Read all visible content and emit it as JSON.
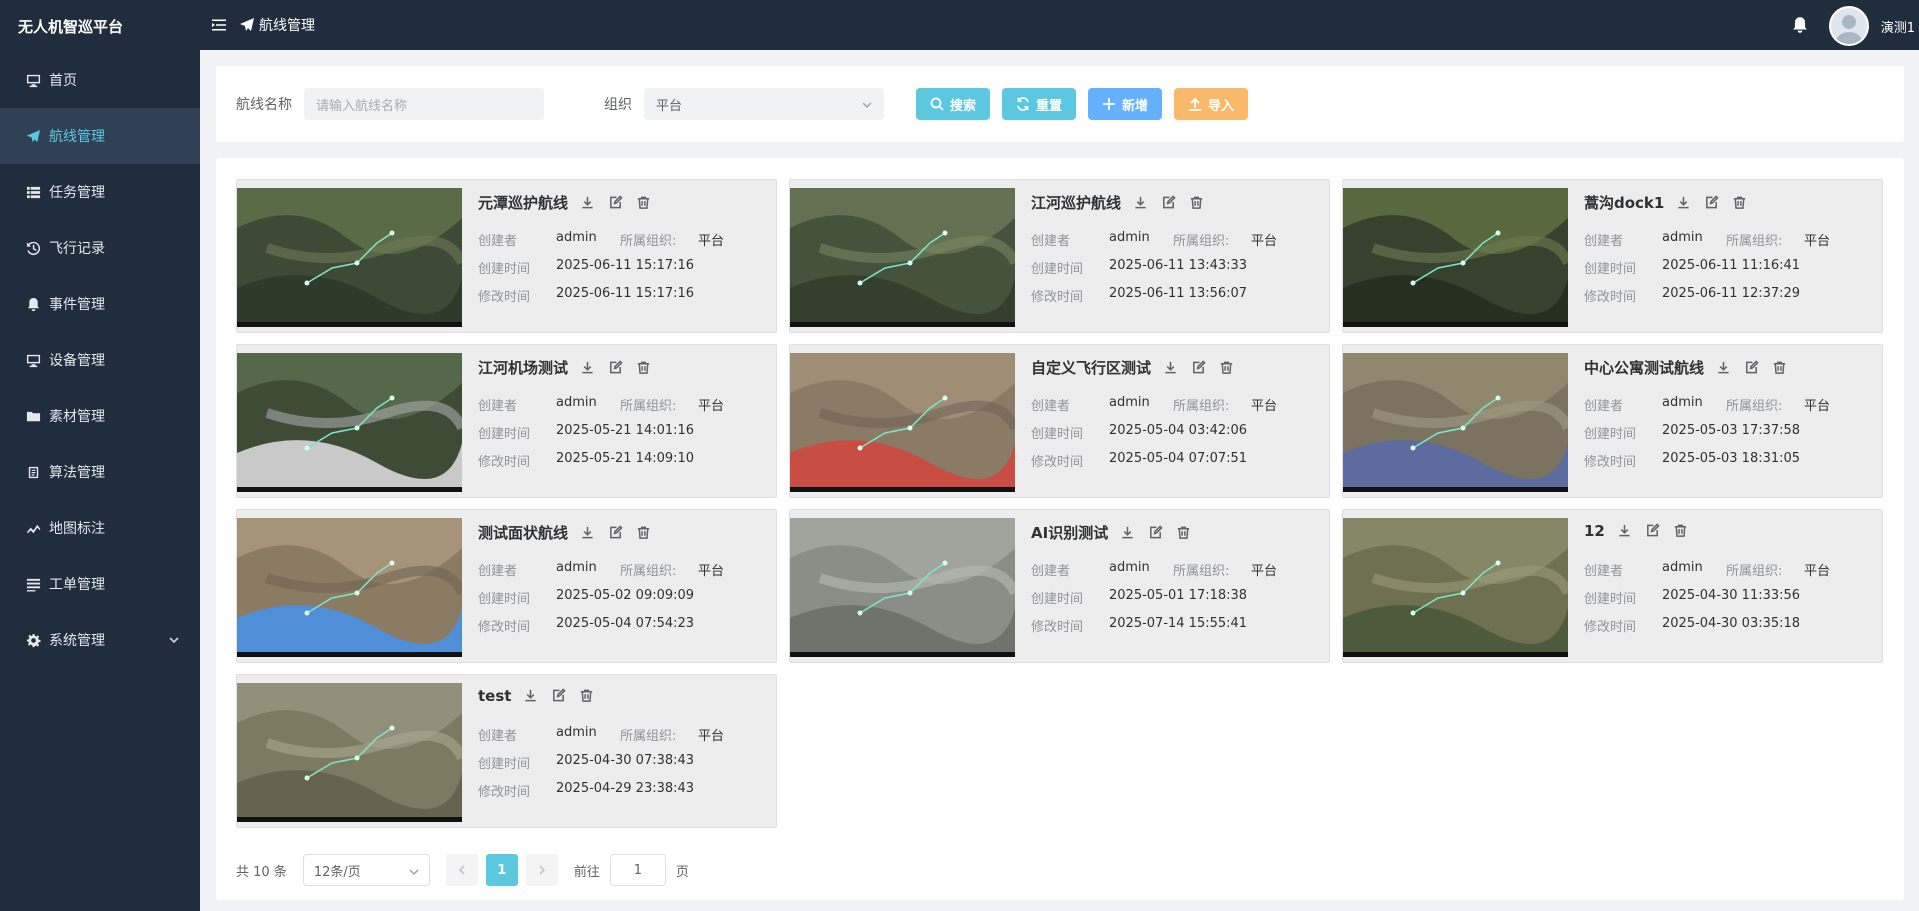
{
  "app": {
    "title": "无人机智巡平台"
  },
  "sidebar": {
    "items": [
      {
        "label": "首页",
        "icon": "monitor-icon"
      },
      {
        "label": "航线管理",
        "icon": "airplane-icon",
        "active": true
      },
      {
        "label": "任务管理",
        "icon": "list-icon"
      },
      {
        "label": "飞行记录",
        "icon": "history-icon"
      },
      {
        "label": "事件管理",
        "icon": "bell-icon"
      },
      {
        "label": "设备管理",
        "icon": "monitor-icon"
      },
      {
        "label": "素材管理",
        "icon": "folder-icon"
      },
      {
        "label": "算法管理",
        "icon": "chip-icon"
      },
      {
        "label": "地图标注",
        "icon": "marker-icon"
      },
      {
        "label": "工单管理",
        "icon": "list-icon"
      },
      {
        "label": "系统管理",
        "icon": "gear-icon"
      }
    ]
  },
  "topbar": {
    "breadcrumb": "航线管理",
    "username": "演测1"
  },
  "search": {
    "name_label": "航线名称",
    "name_placeholder": "请输入航线名称",
    "org_label": "组织",
    "org_value": "平台",
    "btn_search": "搜索",
    "btn_reset": "重置",
    "btn_add": "新增",
    "btn_import": "导入"
  },
  "colors": {
    "accent": "#5cc8e0",
    "add": "#66b1ff",
    "import": "#f9b96c",
    "sidebar": "#1f2d3d"
  },
  "meta_labels": {
    "creator": "创建者",
    "org": "所属组织:",
    "created": "创建时间",
    "modified": "修改时间"
  },
  "routes": [
    {
      "name": "元潭巡护航线",
      "creator": "admin",
      "org": "平台",
      "created": "2025-06-11 15:17:16",
      "modified": "2025-06-11 15:17:16"
    },
    {
      "name": "江河巡护航线",
      "creator": "admin",
      "org": "平台",
      "created": "2025-06-11 13:43:33",
      "modified": "2025-06-11 13:56:07"
    },
    {
      "name": "蒿沟dock1",
      "creator": "admin",
      "org": "平台",
      "created": "2025-06-11 11:16:41",
      "modified": "2025-06-11 12:37:29"
    },
    {
      "name": "江河机场测试",
      "creator": "admin",
      "org": "平台",
      "created": "2025-05-21 14:01:16",
      "modified": "2025-05-21 14:09:10"
    },
    {
      "name": "自定义飞行区测试",
      "creator": "admin",
      "org": "平台",
      "created": "2025-05-04 03:42:06",
      "modified": "2025-05-04 07:07:51"
    },
    {
      "name": "中心公寓测试航线",
      "creator": "admin",
      "org": "平台",
      "created": "2025-05-03 17:37:58",
      "modified": "2025-05-03 18:31:05"
    },
    {
      "name": "测试面状航线",
      "creator": "admin",
      "org": "平台",
      "created": "2025-05-02 09:09:09",
      "modified": "2025-05-04 07:54:23"
    },
    {
      "name": "AI识别测试",
      "creator": "admin",
      "org": "平台",
      "created": "2025-05-01 17:18:38",
      "modified": "2025-07-14 15:55:41"
    },
    {
      "name": "12",
      "creator": "admin",
      "org": "平台",
      "created": "2025-04-30 11:33:56",
      "modified": "2025-04-30 03:35:18"
    },
    {
      "name": "test",
      "creator": "admin",
      "org": "平台",
      "created": "2025-04-30 07:38:43",
      "modified": "2025-04-29 23:38:43"
    }
  ],
  "pagination": {
    "total_text": "共 10 条",
    "page_size": "12条/页",
    "current_page": "1",
    "goto_label": "前往",
    "goto_value": "1",
    "page_suffix": "页"
  }
}
